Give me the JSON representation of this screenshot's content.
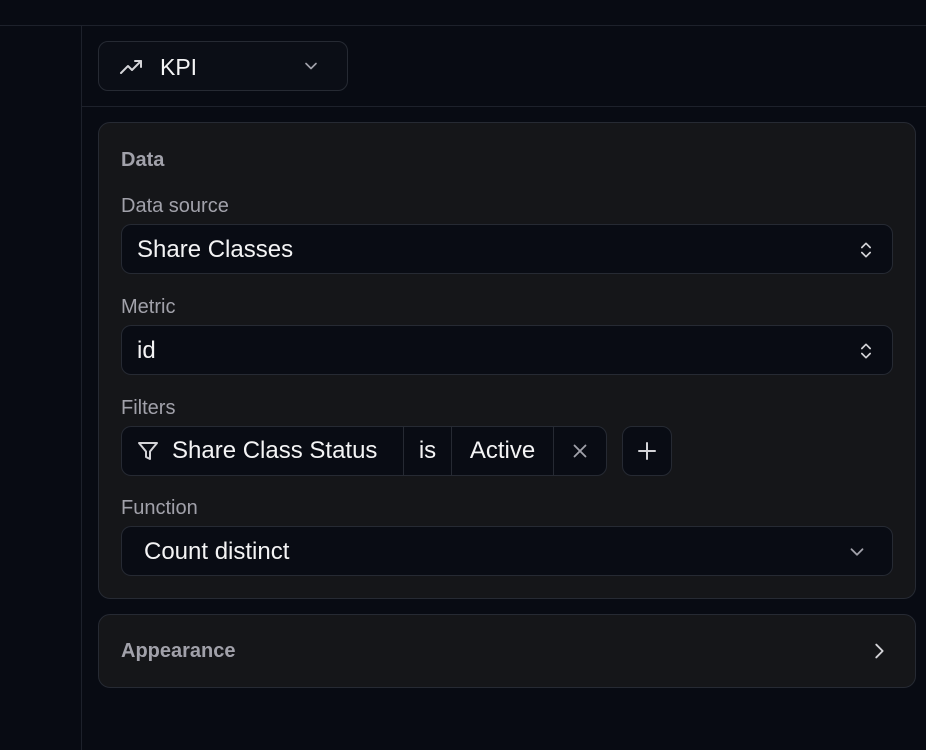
{
  "header": {
    "visualization_type": {
      "label": "KPI",
      "icon": "trending-up-icon"
    }
  },
  "data_panel": {
    "title": "Data",
    "data_source": {
      "label": "Data source",
      "value": "Share Classes"
    },
    "metric": {
      "label": "Metric",
      "value": "id"
    },
    "filters": {
      "label": "Filters",
      "items": [
        {
          "field": "Share Class Status",
          "operator": "is",
          "value": "Active"
        }
      ]
    },
    "function": {
      "label": "Function",
      "value": "Count distinct"
    }
  },
  "appearance_panel": {
    "title": "Appearance"
  },
  "colors": {
    "background": "#080b13",
    "card": "#151619",
    "border": "#262a33",
    "text": "#f4f4f5",
    "muted": "#a1a1aa"
  }
}
